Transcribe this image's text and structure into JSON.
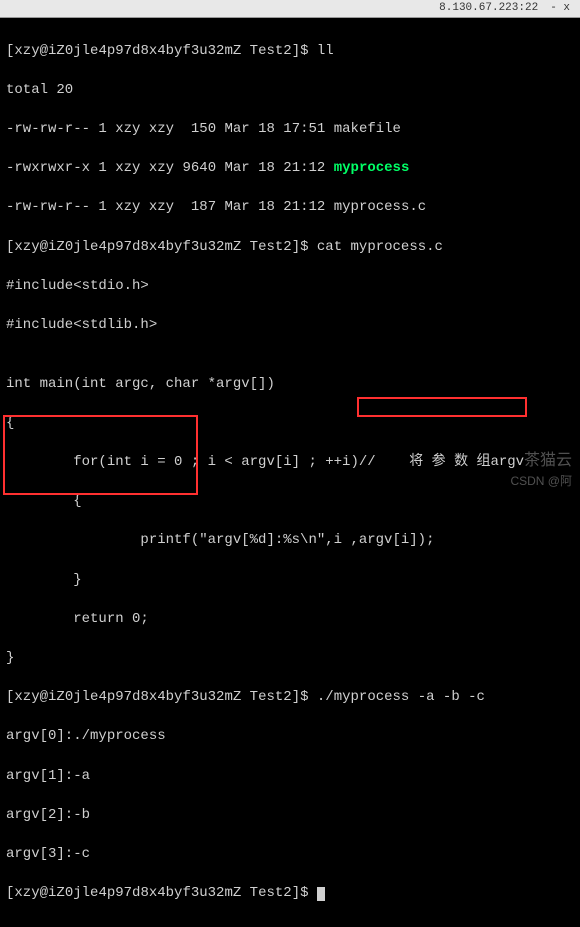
{
  "titlebar": {
    "ip": "8.130.67.223:22",
    "close_label": "- x"
  },
  "prompt": {
    "user": "xzy",
    "host": "iZ0jle4p97d8x4byf3u32mZ",
    "path": "Test2",
    "suffix": "$"
  },
  "cmds": {
    "ll": "ll",
    "cat": "cat myprocess.c",
    "run": "./myprocess -a -b -c",
    "last": ""
  },
  "ll_output": {
    "total": "total 20",
    "rows": [
      {
        "perm": "-rw-rw-r--",
        "n": "1",
        "u": "xzy",
        "g": "xzy",
        "size": " 150",
        "date": "Mar 18 17:51",
        "name": "makefile",
        "exec": false
      },
      {
        "perm": "-rwxrwxr-x",
        "n": "1",
        "u": "xzy",
        "g": "xzy",
        "size": "9640",
        "date": "Mar 18 21:12",
        "name": "myprocess",
        "exec": true
      },
      {
        "perm": "-rw-rw-r--",
        "n": "1",
        "u": "xzy",
        "g": "xzy",
        "size": " 187",
        "date": "Mar 18 21:12",
        "name": "myprocess.c",
        "exec": false
      }
    ]
  },
  "source": {
    "inc1": "#include<stdio.h>",
    "inc2": "#include<stdlib.h>",
    "blank": "",
    "sig": "int main(int argc, char *argv[])",
    "ob": "{",
    "for_line": "        for(int i = 0 ; i < argv[i] ; ++i)//",
    "for_cmt": "    将 参 数 组argv",
    "ob2": "        {",
    "print": "                printf(\"argv[%d]:%s\\n\",i ,argv[i]);",
    "cb2": "        }",
    "ret": "        return 0;",
    "cb": "}"
  },
  "run_output": {
    "r0": "argv[0]:./myprocess",
    "r1": "argv[1]:-a",
    "r2": "argv[2]:-b",
    "r3": "argv[3]:-c"
  },
  "watermark": {
    "top": "茶猫云",
    "bottom": "CSDN @阿"
  }
}
